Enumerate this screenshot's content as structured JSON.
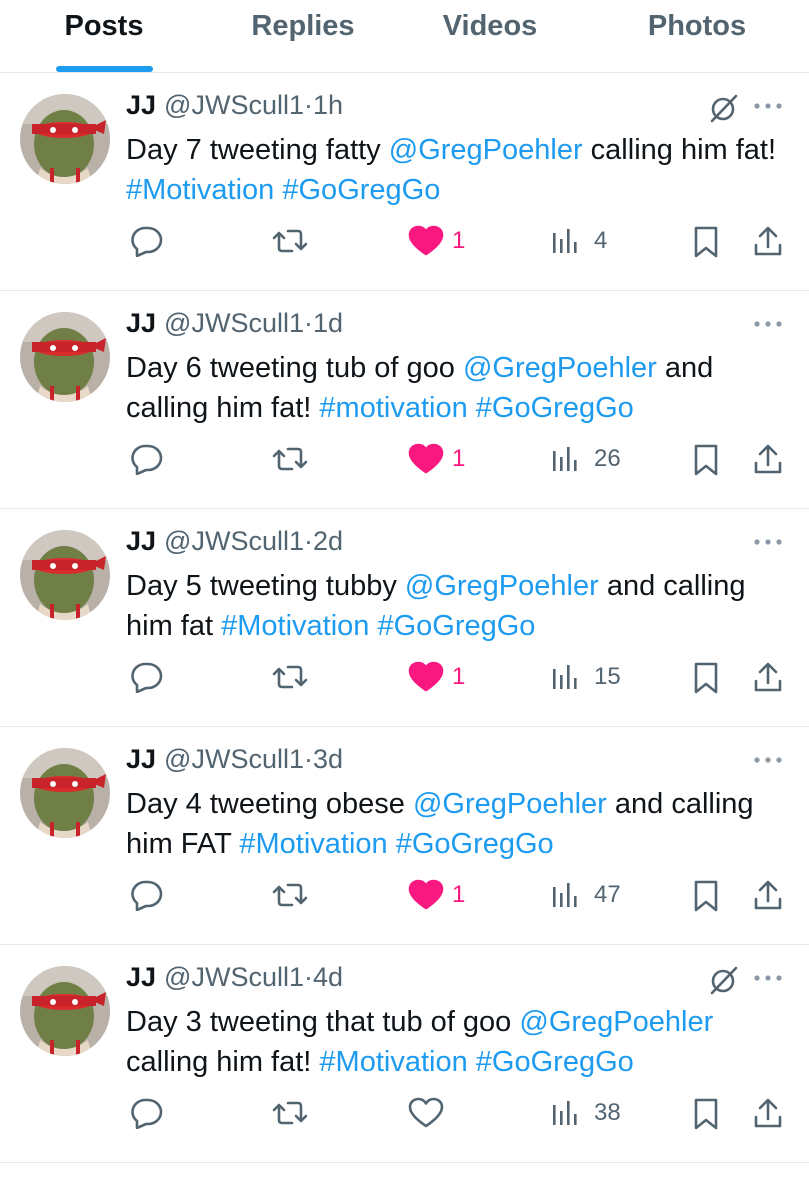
{
  "tabs": [
    {
      "label": "Posts",
      "active": true
    },
    {
      "label": "Replies",
      "active": false
    },
    {
      "label": "Videos",
      "active": false
    },
    {
      "label": "Photos",
      "active": false
    }
  ],
  "colors": {
    "accent": "#1d9bf0",
    "like": "#f91880",
    "muted": "#536471",
    "text": "#0f1419"
  },
  "tweets": [
    {
      "name": "JJ",
      "handle": "@JWScull1",
      "time": "1h",
      "dot": "·",
      "grok_icon": true,
      "text": [
        {
          "t": "Day 7 tweeting fatty ",
          "link": false
        },
        {
          "t": "@GregPoehler",
          "link": true
        },
        {
          "t": " calling him fat! ",
          "link": false
        },
        {
          "t": "#Motivation",
          "link": true
        },
        {
          "t": " ",
          "link": false
        },
        {
          "t": "#GoGregGo",
          "link": true
        }
      ],
      "likes": "1",
      "liked": true,
      "views": "4"
    },
    {
      "name": "JJ",
      "handle": "@JWScull1",
      "time": "1d",
      "dot": "·",
      "grok_icon": false,
      "text": [
        {
          "t": "Day 6 tweeting tub of goo ",
          "link": false
        },
        {
          "t": "@GregPoehler",
          "link": true
        },
        {
          "t": " and calling him fat! ",
          "link": false
        },
        {
          "t": "#motivation",
          "link": true
        },
        {
          "t": " ",
          "link": false
        },
        {
          "t": "#GoGregGo",
          "link": true
        }
      ],
      "likes": "1",
      "liked": true,
      "views": "26"
    },
    {
      "name": "JJ",
      "handle": "@JWScull1",
      "time": "2d",
      "dot": "·",
      "grok_icon": false,
      "text": [
        {
          "t": "Day 5 tweeting tubby ",
          "link": false
        },
        {
          "t": "@GregPoehler",
          "link": true
        },
        {
          "t": " and calling him fat ",
          "link": false
        },
        {
          "t": "#Motivation",
          "link": true
        },
        {
          "t": " ",
          "link": false
        },
        {
          "t": "#GoGregGo",
          "link": true
        }
      ],
      "likes": "1",
      "liked": true,
      "views": "15"
    },
    {
      "name": "JJ",
      "handle": "@JWScull1",
      "time": "3d",
      "dot": "·",
      "grok_icon": false,
      "text": [
        {
          "t": "Day 4 tweeting obese ",
          "link": false
        },
        {
          "t": "@GregPoehler",
          "link": true
        },
        {
          "t": " and calling him FAT ",
          "link": false
        },
        {
          "t": "#Motivation",
          "link": true
        },
        {
          "t": " ",
          "link": false
        },
        {
          "t": "#GoGregGo",
          "link": true
        }
      ],
      "likes": "1",
      "liked": true,
      "views": "47"
    },
    {
      "name": "JJ",
      "handle": "@JWScull1",
      "time": "4d",
      "dot": "·",
      "grok_icon": true,
      "text": [
        {
          "t": "Day 3 tweeting that tub of goo ",
          "link": false
        },
        {
          "t": "@GregPoehler",
          "link": true
        },
        {
          "t": " calling him fat! ",
          "link": false
        },
        {
          "t": "#Motivation",
          "link": true
        },
        {
          "t": " ",
          "link": false
        },
        {
          "t": "#GoGregGo",
          "link": true
        }
      ],
      "likes": "",
      "liked": false,
      "views": "38"
    }
  ]
}
